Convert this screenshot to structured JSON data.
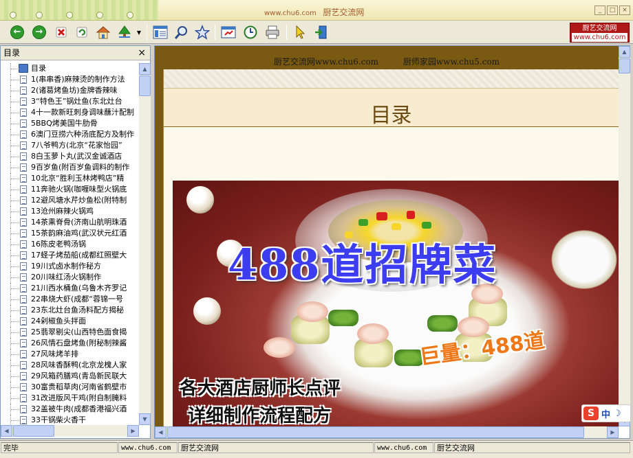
{
  "window": {
    "title_url": "www.chu6.com",
    "title_name": "厨艺交流网",
    "minimize_label": "_",
    "maximize_label": "□",
    "close_label": "×"
  },
  "toolbar": {
    "brand_line1": "厨艺交流网",
    "brand_line2": "www.chu6.com"
  },
  "sidebar": {
    "header": "目录",
    "close_label": "×",
    "root": "目录",
    "items": [
      "1(串串香)麻辣烫的制作方法",
      "2(诸葛烤鱼坊)金牌香辣味",
      "3“特色王”锅灶鱼(东北灶台",
      "4十一款新旺刺身调味蘸汁配制",
      "5BBQ烤美国牛肋骨",
      "6澳门豆捞六种汤底配方及制作",
      "7八爷鸭方(北京“花家怡园”",
      "8白玉萝卜丸(武汉金诚酒店",
      "9百岁鱼(附百岁鱼调料的制作",
      "10北京“胜利玉林烤鸭店”精",
      "11奔驰火锅(咖喱味型火锅底",
      "12避风塘水芹炒鱼松(附特制",
      "13沧州麻辣火锅鸡",
      "14茶熏脊骨(济南山航明珠酒",
      "15茶韵麻油鸡(武汉状元红酒",
      "16陈皮老鸭汤锅",
      "17蛏子烤茄船(成都红照壁大",
      "19川式卤水制作秘方",
      "20川味红汤火锅制作",
      "21川西水桶鱼(乌鲁木齐罗记",
      "22串烧大虾(成都“蓉锦一号",
      "23东北灶台鱼汤料配方揭秘",
      "24剁椒鱼头拌面",
      "25翡翠剔尖(山西特色面食揭",
      "26风情石盘烤鱼(附秘制辣酱",
      "27风味烤羊排",
      "28风味香酥鸭(北京龙槐人家",
      "29风箱药膳鸡(青岛新民联大",
      "30富贵稻草肉(河南省鹤壁市",
      "31改进版风干鸡(附自制腌料",
      "32盖被牛肉(成都香港福兴酒",
      "33干锅柴火香干"
    ]
  },
  "content": {
    "link1": "厨艺交流网www.chu6.com",
    "link2": "厨师家园www.chu5.com",
    "page_title": "目录",
    "cover_title": "488道招牌菜",
    "cover_subtitle": "巨量：488道",
    "cover_line1": "各大酒店厨师长点评",
    "cover_line2": "详细制作流程配方",
    "ime_label": "中"
  },
  "status": {
    "state": "完毕",
    "url1": "www.chu6.com",
    "name1": "厨艺交流网",
    "url2": "www.chu6.com",
    "name2": "厨艺交流网"
  },
  "colors": {
    "accent": "#b01818",
    "page_border": "#7a5a12",
    "cover_title": "#3c3cf0",
    "cover_subtitle": "#ee7818"
  }
}
